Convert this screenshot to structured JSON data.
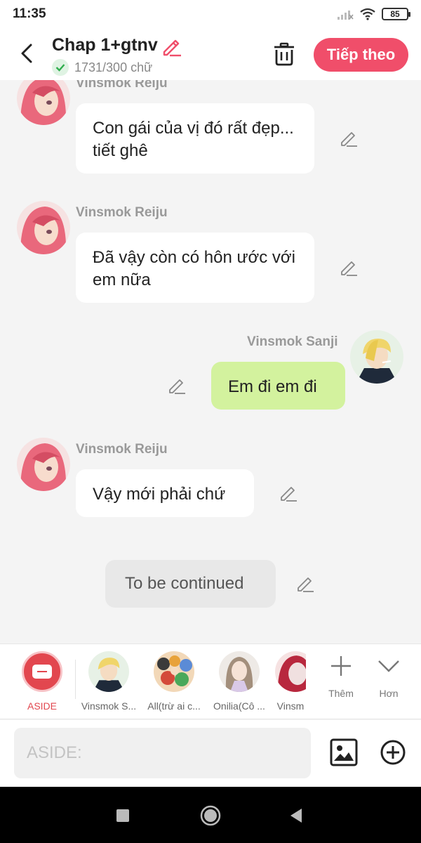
{
  "status_bar": {
    "time": "11:35",
    "battery": "85"
  },
  "header": {
    "title": "Chap 1+gtnv",
    "word_count": "1731/300 chữ",
    "next_label": "Tiếp theo",
    "accent": "#f04e6a"
  },
  "messages": [
    {
      "sender": "Vinsmok Reiju",
      "text": "Con gái của vị đó rất đẹp... tiết ghê",
      "side": "left"
    },
    {
      "sender": "Vinsmok Reiju",
      "text": "Đã vậy còn có hôn ước với em nữa",
      "side": "left"
    },
    {
      "sender": "Vinsmok Sanji",
      "text": "Em đi em đi",
      "side": "right"
    },
    {
      "sender": "Vinsmok Reiju",
      "text": "Vậy mới phải chứ",
      "side": "left"
    },
    {
      "sender": "",
      "text": "To be continued",
      "side": "center"
    }
  ],
  "characters": [
    {
      "label": "ASIDE",
      "icon": "aside-icon"
    },
    {
      "label": "Vinsmok S...",
      "icon": "sanji-avatar"
    },
    {
      "label": "All(trừ ai c...",
      "icon": "group-avatar"
    },
    {
      "label": "Onilia(Cô ...",
      "icon": "onilia-avatar"
    },
    {
      "label": "Vinsm",
      "icon": "reiju-avatar"
    }
  ],
  "tools": {
    "add_label": "Thêm",
    "more_label": "Hơn"
  },
  "input": {
    "placeholder": "ASIDE:"
  }
}
